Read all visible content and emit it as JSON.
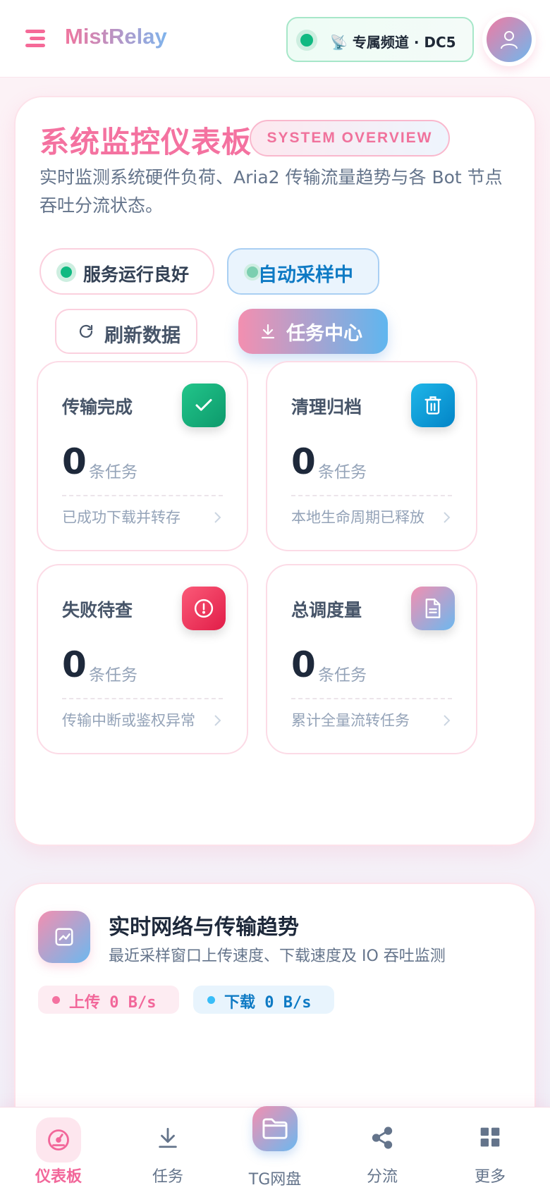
{
  "header": {
    "brand": "MistRelay",
    "channel_label": "📡 专属频道 · DC5"
  },
  "dashboard": {
    "title": "系统监控仪表板",
    "badge": "SYSTEM OVERVIEW",
    "description": "实时监测系统硬件负荷、Aria2 传输流量趋势与各 Bot 节点吞吐分流状态。",
    "status_ok": "服务运行良好",
    "auto_sampling": "自动采样中",
    "refresh_label": "刷新数据",
    "task_center_label": "任务中心",
    "stats": [
      {
        "name": "传输完成",
        "value": "0",
        "unit": "条任务",
        "sub": "已成功下载并转存",
        "icon": "check-icon",
        "color": "#10b981"
      },
      {
        "name": "清理归档",
        "value": "0",
        "unit": "条任务",
        "sub": "本地生命周期已释放",
        "icon": "trash-icon",
        "color": "#0ea5e9"
      },
      {
        "name": "失败待查",
        "value": "0",
        "unit": "条任务",
        "sub": "传输中断或鉴权异常",
        "icon": "alert-icon",
        "color": "#f43f5e"
      },
      {
        "name": "总调度量",
        "value": "0",
        "unit": "条任务",
        "sub": "累计全量流转任务",
        "icon": "document-icon",
        "color": "#a78bfa"
      }
    ]
  },
  "trend": {
    "title": "实时网络与传输趋势",
    "subtitle": "最近采样窗口上传速度、下载速度及 IO 吞吐监测",
    "upload": "上传 0 B/s",
    "download": "下载 0 B/s"
  },
  "bottom_nav": {
    "items": [
      {
        "label": "仪表板",
        "icon": "gauge-icon",
        "active": true
      },
      {
        "label": "任务",
        "icon": "download-icon",
        "active": false
      },
      {
        "label": "TG网盘",
        "icon": "folder-icon",
        "active": false
      },
      {
        "label": "分流",
        "icon": "share-icon",
        "active": false
      },
      {
        "label": "更多",
        "icon": "grid-icon",
        "active": false
      }
    ]
  }
}
